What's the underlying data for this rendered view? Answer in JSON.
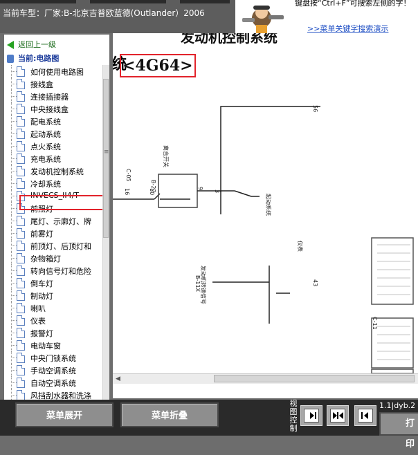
{
  "header": {
    "car_model": "当前车型：厂家:B-北京吉普欧蓝德(Outlander）2006",
    "tip_text": "键盘按“Ctrl+F”可搜索左侧的字！",
    "tip_link": ">>菜单关键字搜索演示"
  },
  "sidebar": {
    "back_label": "返回上一级",
    "current_label": "当前:电路图",
    "items": [
      {
        "label": "如何使用电路图"
      },
      {
        "label": "接线盒"
      },
      {
        "label": "连接插接器"
      },
      {
        "label": "中央接线盒"
      },
      {
        "label": "配电系统"
      },
      {
        "label": "起动系统"
      },
      {
        "label": "点火系统"
      },
      {
        "label": "充电系统"
      },
      {
        "label": "发动机控制系统"
      },
      {
        "label": "冷却系统"
      },
      {
        "label": "INVECS_II4/T"
      },
      {
        "label": "前照灯"
      },
      {
        "label": "尾灯、示廓灯、牌"
      },
      {
        "label": "前雾灯"
      },
      {
        "label": "前顶灯、后顶灯和"
      },
      {
        "label": "杂物箱灯"
      },
      {
        "label": "转向信号灯和危险"
      },
      {
        "label": "倒车灯"
      },
      {
        "label": "制动灯"
      },
      {
        "label": "喇叭"
      },
      {
        "label": "仪表"
      },
      {
        "label": "报警灯"
      },
      {
        "label": "电动车窗"
      },
      {
        "label": "中央门锁系统"
      },
      {
        "label": "手动空调系统"
      },
      {
        "label": "自动空调系统"
      },
      {
        "label": "风挡刮水器和洗涤"
      }
    ],
    "selected_index": 8
  },
  "diagram": {
    "title": "发动机控制系统",
    "engine_prefix": "统",
    "engine_code": "<4G64>",
    "labels": {
      "connector_top": "56",
      "connector_ref_1": "C-05",
      "connector_ref_2": "B-22",
      "connector_ref_3": "B-11X",
      "connector_ref_4": "C-11",
      "pin_16": "16",
      "pin_10": "10",
      "pin_9": "9",
      "pin_3": "3",
      "pin_43": "43",
      "label_start": "起动系统",
      "label_instr": "仪表",
      "label_switch": "离合开关",
      "label_engine_speed": "发动机转速信号"
    }
  },
  "footer": {
    "expand_label": "菜单展开",
    "collapse_label": "菜单折叠",
    "view_label": "视图控制",
    "page_info": "1.1|dyb.2",
    "print_label": "打印"
  },
  "colors": {
    "highlight": "#e2232b",
    "panel_bg": "#6d6d6d",
    "link": "#1f4fc4"
  }
}
